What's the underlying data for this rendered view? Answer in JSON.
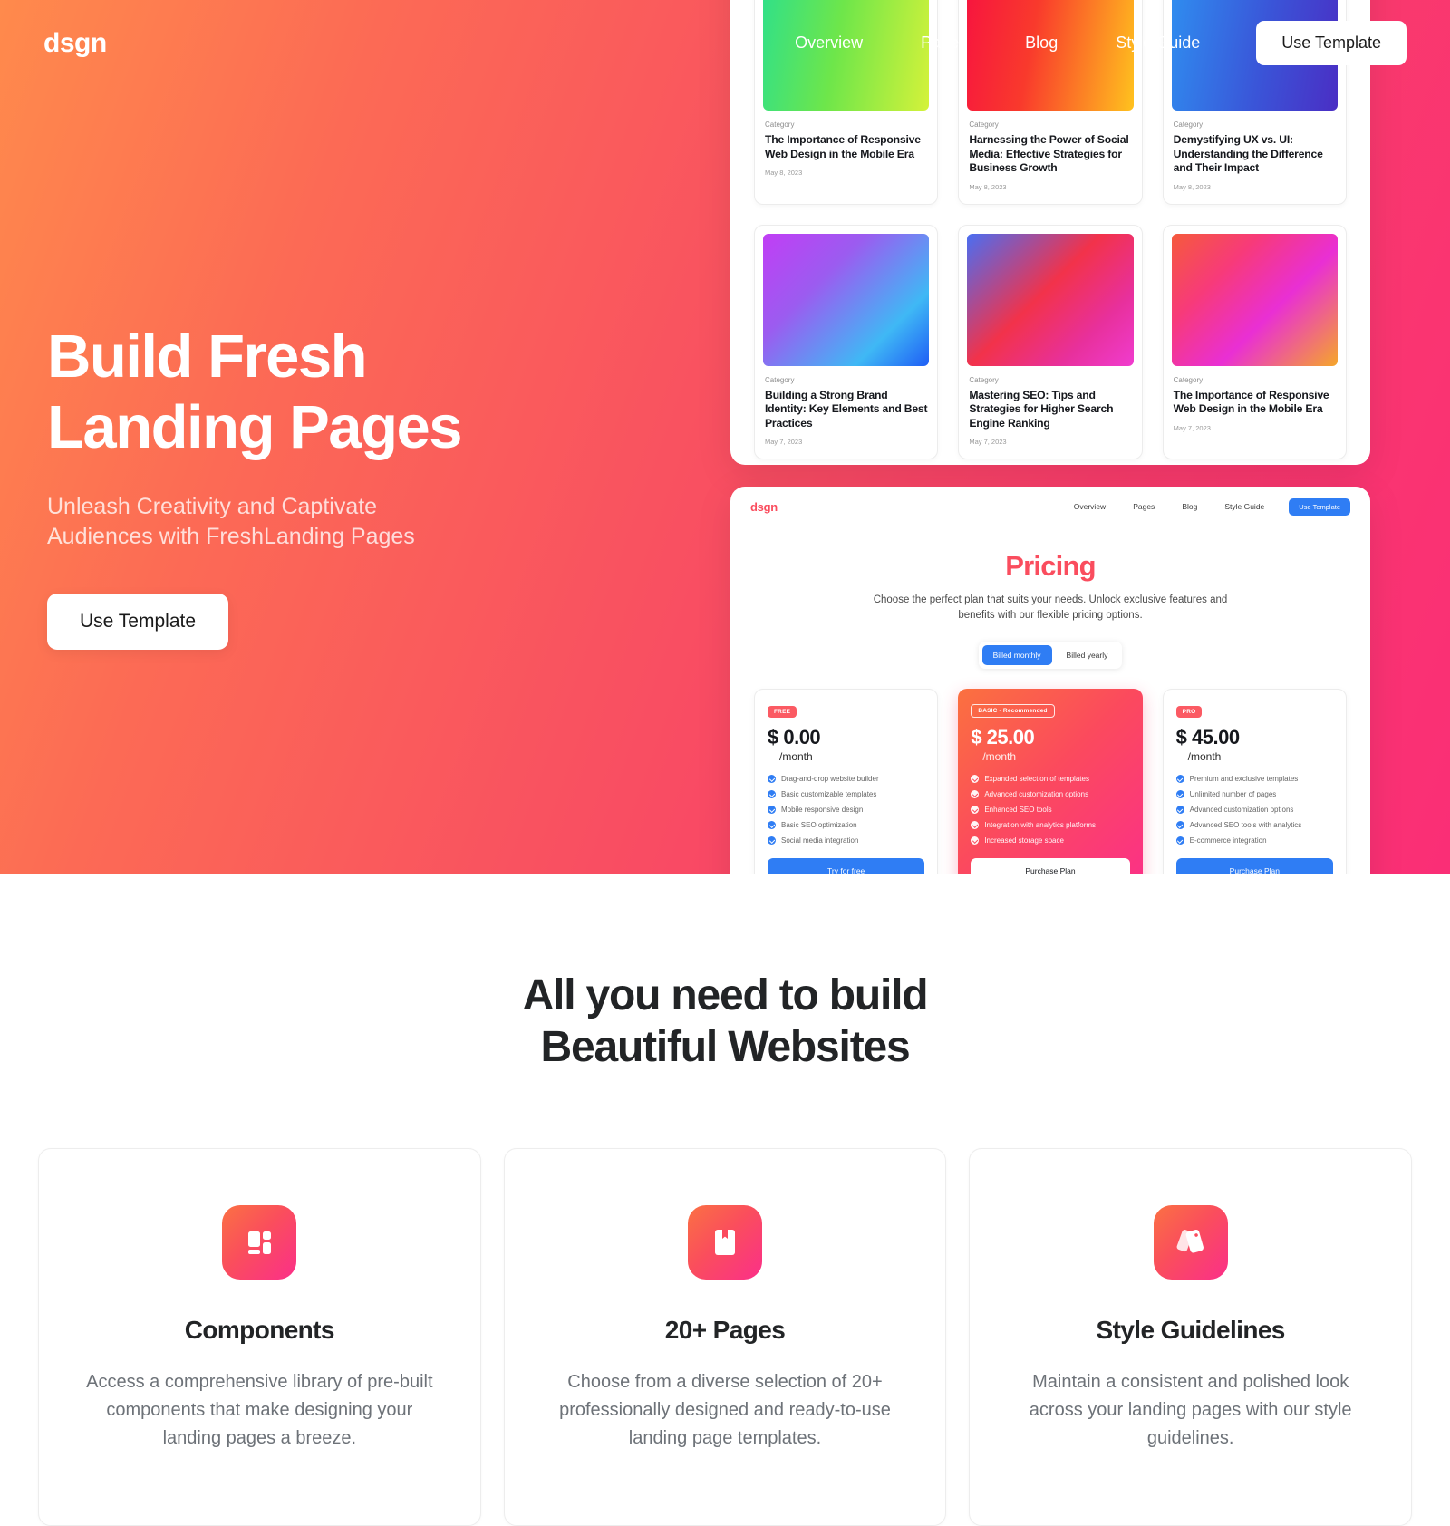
{
  "brand": {
    "logo": "dsgn",
    "accent": "#fa4d5e",
    "blue": "#2f7df4"
  },
  "nav": {
    "links": [
      {
        "label": "Overview"
      },
      {
        "label": "Pages"
      },
      {
        "label": "Blog"
      },
      {
        "label": "Style Guide"
      }
    ],
    "cta": "Use Template"
  },
  "hero": {
    "title_line1": "Build Fresh",
    "title_line2": "Landing Pages",
    "subtitle": "Unleash Creativity and Captivate Audiences with FreshLanding Pages",
    "cta": "Use Template"
  },
  "blog_preview": {
    "cards": [
      {
        "category": "Category",
        "title": "The Importance of Responsive Web Design in the Mobile Era",
        "date": "May 8, 2023",
        "gradient": "linear-gradient(100deg, #2fe08a 0%, #6ee64a 45%, #d4f23a 100%)"
      },
      {
        "category": "Category",
        "title": "Harnessing the Power of Social Media: Effective Strategies for Business Growth",
        "date": "May 8, 2023",
        "gradient": "linear-gradient(100deg, #f7143f 0%, #f93a2c 40%, #ffc21e 100%)"
      },
      {
        "category": "Category",
        "title": "Demystifying UX vs. UI: Understanding the Difference and Their Impact",
        "date": "May 8, 2023",
        "gradient": "linear-gradient(100deg, #2f8ef0 0%, #3a55d8 55%, #4a2ec4 100%)"
      },
      {
        "category": "Category",
        "title": "Building a Strong Brand Identity: Key Elements and Best Practices",
        "date": "May 7, 2023",
        "gradient": "linear-gradient(135deg, #c13ef5 0%, #9b5cf0 35%, #3fb8f5 75%, #1f5ef5 100%)"
      },
      {
        "category": "Category",
        "title": "Mastering SEO: Tips and Strategies for Higher Search Engine Ranking",
        "date": "May 7, 2023",
        "gradient": "linear-gradient(135deg, #4a6ef2 0%, #f2324a 45%, #e8309c 75%, #f03ccf 100%)"
      },
      {
        "category": "Category",
        "title": "The Importance of Responsive Web Design in the Mobile Era",
        "date": "May 7, 2023",
        "gradient": "linear-gradient(135deg, #f55a3c 0%, #f73a7a 30%, #e92fd4 60%, #f5a62a 100%)"
      }
    ]
  },
  "pricing_preview": {
    "nav": {
      "logo": "dsgn",
      "links": [
        {
          "label": "Overview"
        },
        {
          "label": "Pages"
        },
        {
          "label": "Blog"
        },
        {
          "label": "Style Guide"
        }
      ],
      "cta": "Use Template"
    },
    "title": "Pricing",
    "description": "Choose the perfect plan that suits your needs. Unlock exclusive features and benefits with our flexible pricing options.",
    "billing_options": [
      {
        "label": "Billed monthly",
        "active": true
      },
      {
        "label": "Billed yearly",
        "active": false
      }
    ],
    "plans": [
      {
        "badge": "FREE",
        "price": "$ 0.00",
        "period": "/month",
        "features": [
          "Drag-and-drop website builder",
          "Basic customizable templates",
          "Mobile responsive design",
          "Basic SEO optimization",
          "Social media integration"
        ],
        "button": "Try for free",
        "featured": false
      },
      {
        "badge": "BASIC - Recommended",
        "price": "$ 25.00",
        "period": "/month",
        "features": [
          "Expanded selection of templates",
          "Advanced customization options",
          "Enhanced SEO tools",
          "Integration with analytics platforms",
          "Increased storage space"
        ],
        "button": "Purchase Plan",
        "featured": true
      },
      {
        "badge": "PRO",
        "price": "$ 45.00",
        "period": "/month",
        "features": [
          "Premium and exclusive templates",
          "Unlimited number of pages",
          "Advanced customization options",
          "Advanced SEO tools with analytics",
          "E-commerce integration"
        ],
        "button": "Purchase Plan",
        "featured": false
      }
    ]
  },
  "features_section": {
    "heading_line1": "All you need to build",
    "heading_line2": "Beautiful Websites",
    "cards": [
      {
        "icon": "grid-layout-icon",
        "title": "Components",
        "description": "Access a comprehensive library of pre-built components that make designing your landing pages a breeze."
      },
      {
        "icon": "bookmark-page-icon",
        "title": "20+ Pages",
        "description": "Choose from a diverse selection of 20+ professionally designed and ready-to-use landing page templates."
      },
      {
        "icon": "style-cards-icon",
        "title": "Style Guidelines",
        "description": "Maintain a consistent and polished look across your landing pages with our style guidelines."
      }
    ]
  }
}
